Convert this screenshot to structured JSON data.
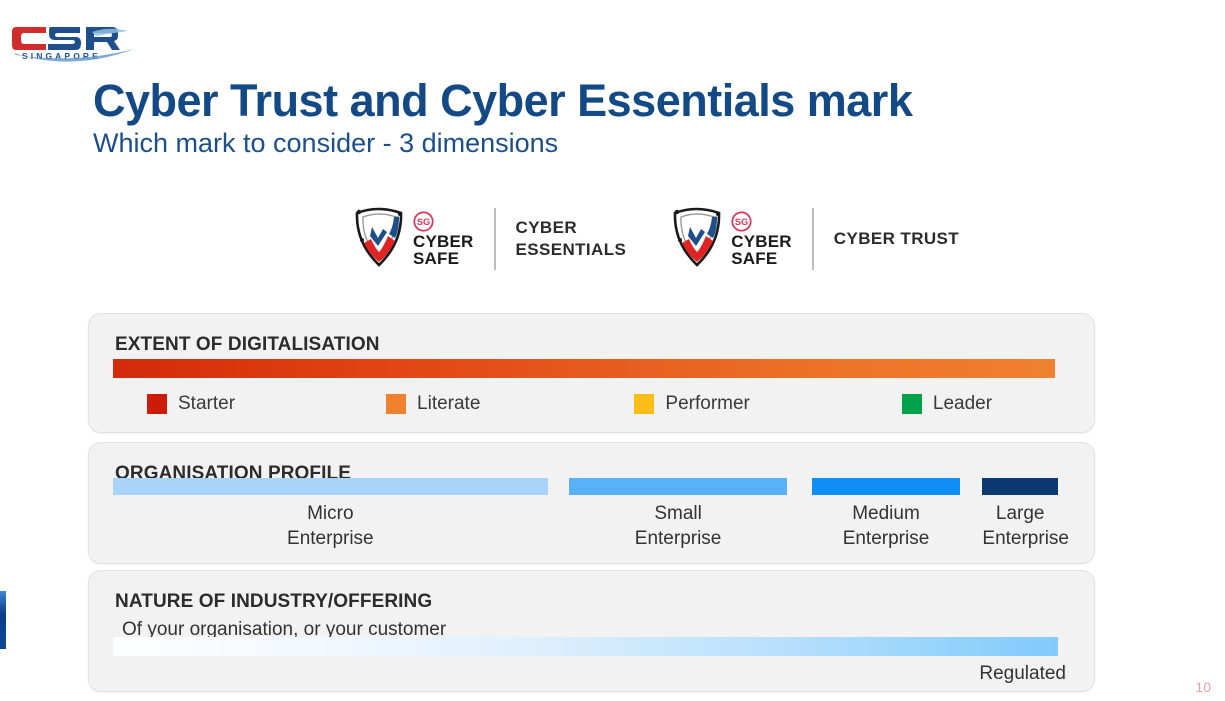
{
  "slide": {
    "title": "Cyber Trust and Cyber Essentials mark",
    "subtitle": "Which mark to consider - 3 dimensions",
    "page_number": "10",
    "title_color": "#134a86"
  },
  "logo": {
    "name": "csa-singapore-logo",
    "text_c": "C",
    "text_sa": "SA",
    "tagline": "SINGAPORE",
    "red": "#d22b2b",
    "blue": "#1f4e8c"
  },
  "badges": [
    {
      "mark_sg": "SG",
      "mark_line1": "CYBER",
      "mark_line2": "SAFE",
      "scheme": "CYBER\nESSENTIALS"
    },
    {
      "mark_sg": "SG",
      "mark_line1": "CYBER",
      "mark_line2": "SAFE",
      "scheme": "CYBER TRUST"
    }
  ],
  "panels": {
    "digitalisation": {
      "heading": "EXTENT OF DIGITALISATION",
      "bar_from": "#d42a0c",
      "bar_to": "#ef8130",
      "legend": [
        {
          "label": "Starter",
          "color": "#cc1b09"
        },
        {
          "label": "Literate",
          "color": "#ef8130"
        },
        {
          "label": "Performer",
          "color": "#fcbd16"
        },
        {
          "label": "Leader",
          "color": "#00a14b"
        }
      ]
    },
    "organisation": {
      "heading": "ORGANISATION PROFILE",
      "segments": [
        {
          "line1": "Micro",
          "line2": "Enterprise",
          "color": "#a8d4fb",
          "left_pct": 0,
          "width_pct": 46
        },
        {
          "line1": "Small",
          "line2": "Enterprise",
          "color": "#59b1f7",
          "left_pct": 48.3,
          "width_pct": 23
        },
        {
          "line1": "Medium",
          "line2": "Enterprise",
          "color": "#0e8ef4",
          "left_pct": 74,
          "width_pct": 15.6
        },
        {
          "line1": "Large",
          "line2": "Enterprise",
          "color": "#0c3a70",
          "left_pct": 92,
          "width_pct": 8
        }
      ]
    },
    "industry": {
      "heading": "NATURE OF INDUSTRY/OFFERING",
      "subheading": "Of your organisation, or your customer",
      "caption": "Regulated",
      "bar_from": "#ffffff",
      "bar_to": "#82cbfb"
    }
  }
}
